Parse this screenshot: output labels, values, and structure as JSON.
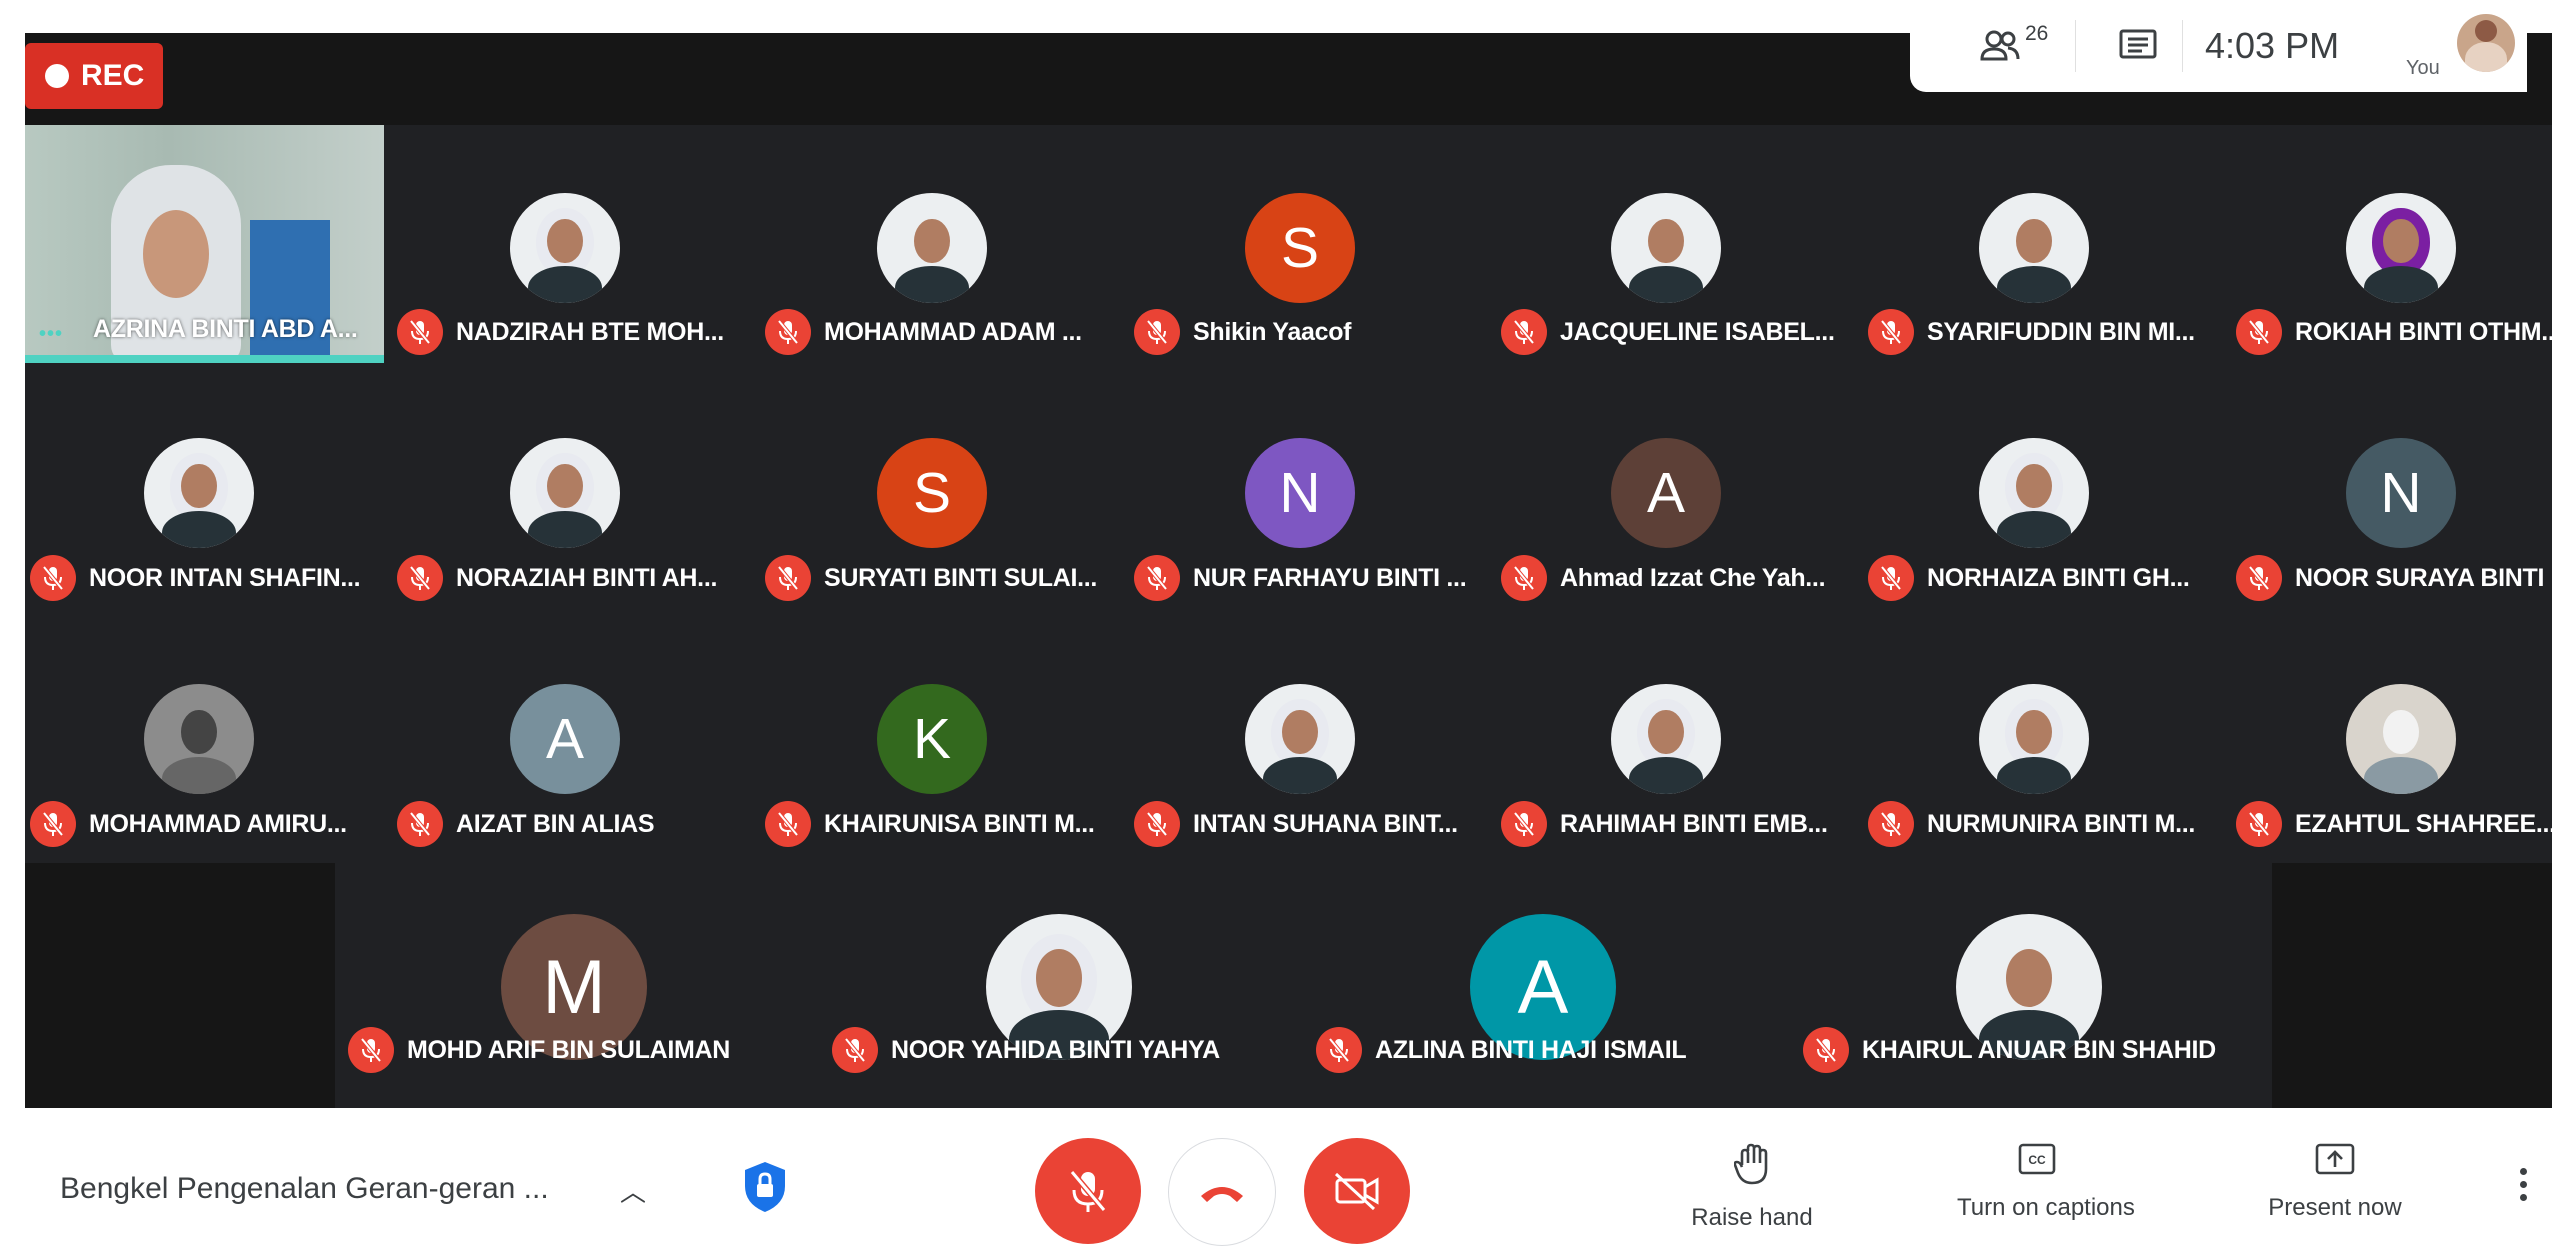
{
  "recording": {
    "label": "REC"
  },
  "info_panel": {
    "people_count": "26",
    "time": "4:03 PM",
    "self_label": "You"
  },
  "self_view": {
    "name": "AZRINA BINTI ABD A..."
  },
  "participants": [
    {
      "name": "NADZIRAH BTE MOH...",
      "avatar_type": "photo",
      "avatar_icon": "woman-hijab-avatar"
    },
    {
      "name": "MOHAMMAD ADAM ...",
      "avatar_type": "photo",
      "avatar_icon": "man-suit-avatar"
    },
    {
      "name": "Shikin Yaacof",
      "avatar_type": "letter",
      "initial": "S",
      "color": "#d84315"
    },
    {
      "name": "JACQUELINE ISABEL...",
      "avatar_type": "photo",
      "avatar_icon": "woman-avatar"
    },
    {
      "name": "SYARIFUDDIN BIN MI...",
      "avatar_type": "photo",
      "avatar_icon": "man-avatar"
    },
    {
      "name": "ROKIAH BINTI OTHM...",
      "avatar_type": "photo",
      "avatar_icon": "woman-purple-hijab-avatar"
    },
    {
      "name": "NOOR INTAN SHAFIN...",
      "avatar_type": "photo",
      "avatar_icon": "woman-hijab-avatar"
    },
    {
      "name": "NORAZIAH BINTI AH...",
      "avatar_type": "photo",
      "avatar_icon": "woman-hijab-avatar"
    },
    {
      "name": "SURYATI BINTI SULAI...",
      "avatar_type": "letter",
      "initial": "S",
      "color": "#d84315"
    },
    {
      "name": "NUR FARHAYU BINTI ...",
      "avatar_type": "letter",
      "initial": "N",
      "color": "#7e57c2"
    },
    {
      "name": "Ahmad Izzat Che Yah...",
      "avatar_type": "letter",
      "initial": "A",
      "color": "#5d4037"
    },
    {
      "name": "NORHAIZA BINTI GH...",
      "avatar_type": "photo",
      "avatar_icon": "woman-hijab-avatar"
    },
    {
      "name": "NOOR SURAYA BINTI ...",
      "avatar_type": "letter",
      "initial": "N",
      "color": "#455a64"
    },
    {
      "name": "MOHAMMAD AMIRU...",
      "avatar_type": "photo",
      "avatar_icon": "monochrome-avatar"
    },
    {
      "name": "AIZAT BIN ALIAS",
      "avatar_type": "letter",
      "initial": "A",
      "color": "#78909c"
    },
    {
      "name": "KHAIRUNISA BINTI M...",
      "avatar_type": "letter",
      "initial": "K",
      "color": "#33691e"
    },
    {
      "name": "INTAN SUHANA BINT...",
      "avatar_type": "photo",
      "avatar_icon": "woman-hijab-avatar"
    },
    {
      "name": "RAHIMAH BINTI EMB...",
      "avatar_type": "photo",
      "avatar_icon": "woman-hijab-avatar"
    },
    {
      "name": "NURMUNIRA BINTI M...",
      "avatar_type": "photo",
      "avatar_icon": "woman-hijab-avatar"
    },
    {
      "name": "EZAHTUL SHAHREE...",
      "avatar_type": "photo",
      "avatar_icon": "objects-avatar"
    },
    {
      "name": "MOHD ARIF BIN SULAIMAN",
      "avatar_type": "letter",
      "initial": "M",
      "color": "#6d4c41"
    },
    {
      "name": "NOOR YAHIDA BINTI YAHYA",
      "avatar_type": "photo",
      "avatar_icon": "woman-hijab-avatar"
    },
    {
      "name": "AZLINA BINTI HAJI ISMAIL",
      "avatar_type": "letter",
      "initial": "A",
      "color": "#0097a7"
    },
    {
      "name": "KHAIRUL ANUAR BIN SHAHID",
      "avatar_type": "photo",
      "avatar_icon": "man-avatar"
    }
  ],
  "meeting": {
    "title": "Bengkel Pengenalan Geran-geran ..."
  },
  "controls": {
    "raise_hand": "Raise hand",
    "captions": "Turn on captions",
    "present": "Present now"
  },
  "colors": {
    "accent_red": "#ea4335",
    "active_speaker": "#4fd2c2",
    "stage_bg": "#202124"
  }
}
